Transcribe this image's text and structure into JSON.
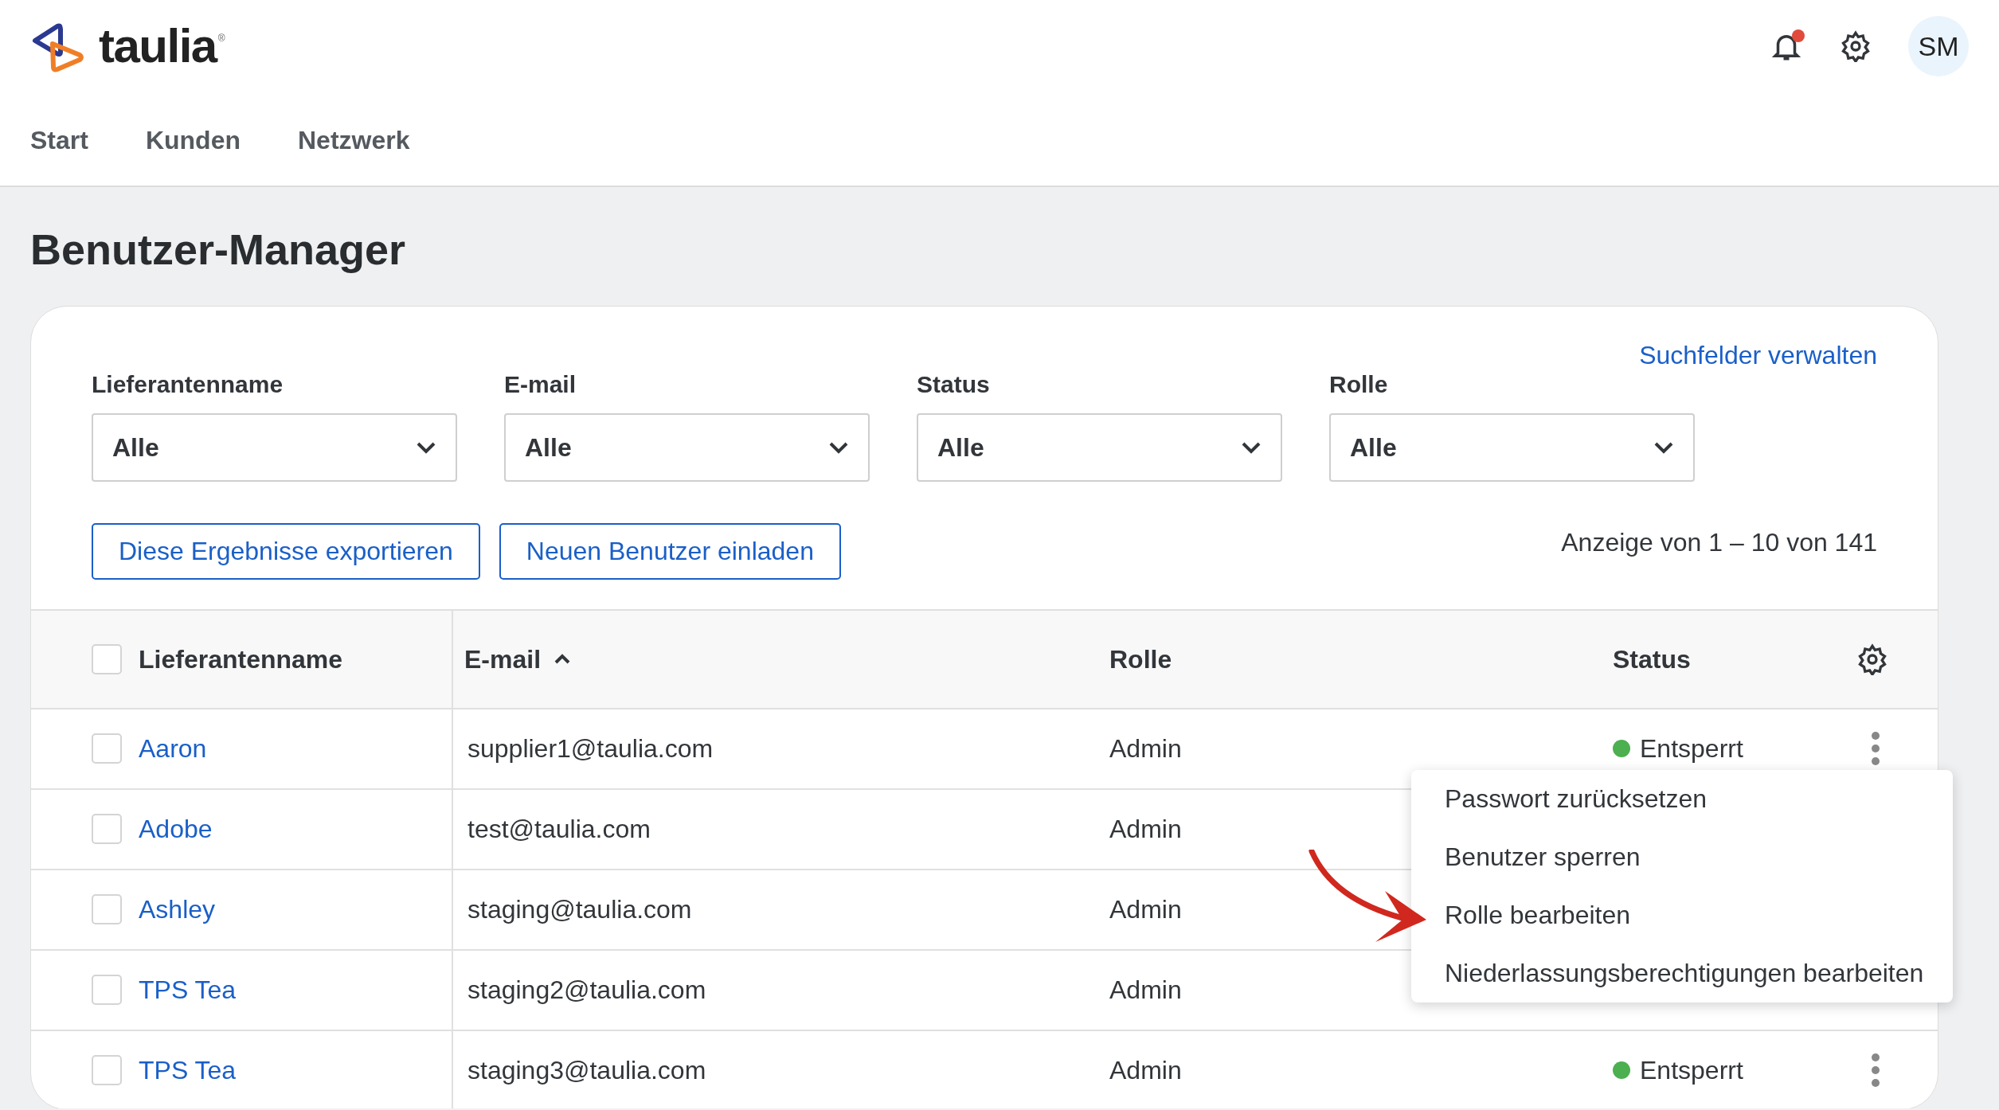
{
  "header": {
    "logo_text": "taulia",
    "registered_mark": "®",
    "has_unread_notifications": true,
    "avatar": "SM",
    "nav": [
      {
        "label": "Start"
      },
      {
        "label": "Kunden"
      },
      {
        "label": "Netzwerk"
      }
    ]
  },
  "page_title": "Benutzer-Manager",
  "filters": [
    {
      "label": "Lieferantenname",
      "value": "Alle"
    },
    {
      "label": "E-mail",
      "value": "Alle"
    },
    {
      "label": "Status",
      "value": "Alle"
    },
    {
      "label": "Rolle",
      "value": "Alle"
    }
  ],
  "manage_fields_link": "Suchfelder verwalten",
  "actions": [
    "Diese Ergebnisse exportieren",
    "Neuen Benutzer einladen"
  ],
  "result_count": "Anzeige von 1 – 10 von 141",
  "table": {
    "select_all_checked": false,
    "columns": [
      {
        "label": "Lieferantenname",
        "sorted_ascending": false
      },
      {
        "label": "E-mail",
        "sorted_ascending": true
      },
      {
        "label": "Rolle",
        "sorted_ascending": false
      },
      {
        "label": "Status",
        "sorted_ascending": false
      }
    ],
    "rows": [
      {
        "checked": false,
        "name": "Aaron",
        "email": "supplier1@taulia.com",
        "role": "Admin",
        "status": "Entsperrt",
        "color": "#4caf50"
      },
      {
        "checked": false,
        "name": "Adobe",
        "email": "test@taulia.com",
        "role": "Admin"
      },
      {
        "checked": false,
        "name": "Ashley",
        "email": "staging@taulia.com",
        "role": "Admin"
      },
      {
        "checked": false,
        "name": "TPS Tea",
        "email": "staging2@taulia.com",
        "role": "Admin"
      },
      {
        "checked": false,
        "name": "TPS Tea",
        "email": "staging3@taulia.com",
        "role": "Admin",
        "status": "Entsperrt",
        "color": "#4caf50"
      }
    ]
  },
  "row_menu": {
    "items": [
      "Passwort zurücksetzen",
      "Benutzer sperren",
      "Rolle bearbeiten",
      "Niederlassungsberechtigungen bearbeiten"
    ]
  }
}
